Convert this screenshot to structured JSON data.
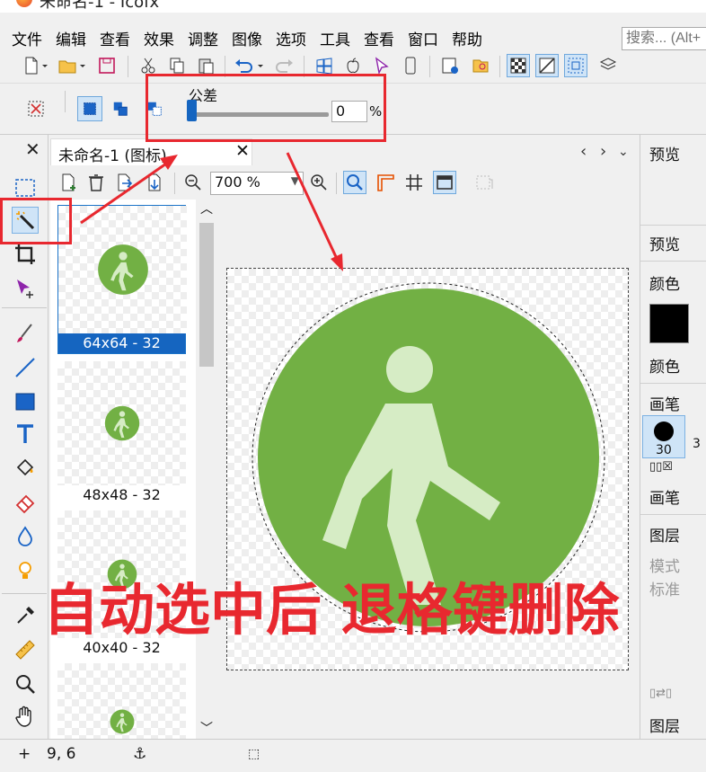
{
  "window": {
    "title": "未命名-1 - Icofx"
  },
  "menu": [
    "文件",
    "编辑",
    "查看",
    "效果",
    "调整",
    "图像",
    "选项",
    "工具",
    "查看",
    "窗口",
    "帮助"
  ],
  "search": {
    "placeholder": "搜索... (Alt+"
  },
  "options": {
    "tolerance_label": "公差",
    "tolerance_value": "0",
    "tolerance_unit": "%"
  },
  "document": {
    "tab_label": "未命名-1 (图标)",
    "zoom": "700 %"
  },
  "thumbnails": [
    {
      "caption": "64x64 - 32",
      "selected": true
    },
    {
      "caption": "48x48 - 32",
      "selected": false
    },
    {
      "caption": "40x40 - 32",
      "selected": false
    },
    {
      "caption": "",
      "selected": false
    }
  ],
  "right_panel": {
    "preview_header": "预览",
    "preview_footer": "预览",
    "color_header": "颜色",
    "color_footer": "颜色",
    "brush_header": "画笔",
    "brush_size": "30",
    "brush_next": "3",
    "brush_footer": "画笔",
    "layers_header": "图层",
    "layers_mode": "模式",
    "layers_standard": "标准",
    "layers_footer": "图层"
  },
  "status": {
    "cursor_pos": "9, 6"
  },
  "annotation": {
    "text": "自动选中后 退格键删除"
  },
  "colors": {
    "accent": "#1565c0",
    "icon_green": "#72b044",
    "annotation_red": "#e8282f",
    "figure": "#d6ecc5"
  }
}
